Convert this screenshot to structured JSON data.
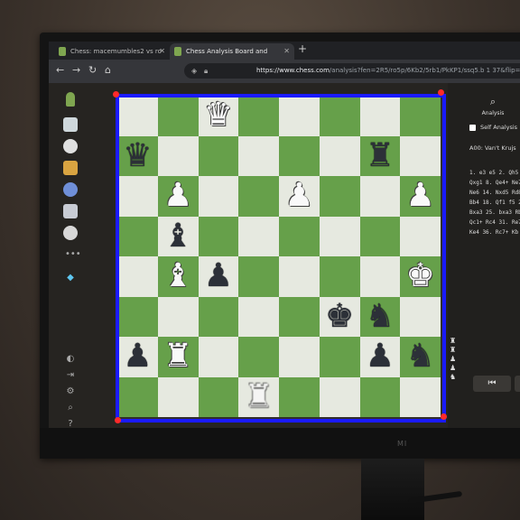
{
  "browser": {
    "tabs": [
      {
        "label": "Chess: macemumbles2 vs ro"
      },
      {
        "label": "Chess Analysis Board and"
      }
    ],
    "new_tab": "+",
    "url_host": "https://www.chess.com",
    "url_path": "/analysis?fen=2R5/ro5p/6Kb2/5rb1/PkKP1/ssq5.b 1 37&flip=misc"
  },
  "board": {
    "ranks": [
      [
        "",
        "",
        "wQ",
        "",
        "",
        "",
        "",
        ""
      ],
      [
        "bQ",
        "",
        "",
        "",
        "",
        "",
        "bR",
        ""
      ],
      [
        "",
        "wP",
        "",
        "",
        "wP",
        "",
        "",
        "wP"
      ],
      [
        "",
        "bB",
        "",
        "",
        "",
        "",
        "",
        ""
      ],
      [
        "",
        "wB",
        "bP",
        "",
        "",
        "",
        "",
        "wK"
      ],
      [
        "",
        "",
        "",
        "",
        "",
        "bK",
        "bN",
        ""
      ],
      [
        "bP",
        "wR",
        "",
        "",
        "",
        "",
        "bP",
        "bN"
      ],
      [
        "",
        "",
        "",
        "wR",
        "",
        "",
        "",
        ""
      ]
    ]
  },
  "panel": {
    "analysis_label": "Analysis",
    "self_analysis": "Self Analysis",
    "opening": "A00: Van't Krujs",
    "moves": [
      "1. e3 e5 2. Qh5 Qf",
      "Qxg1 8. Qe4+ Ne7",
      "Ne6 14. Nxd5 Rd8",
      "Bb4 18. Qf1 f5 20.",
      "Bxa3 25. bxa3 Rb",
      "Qc1+ Rc4 31. Re7",
      "Ke4 36. Rc7+ Kb"
    ]
  },
  "monitor_brand": "MI",
  "colors": {
    "board_light": "#e6e9e0",
    "board_dark": "#66a04a",
    "outline": "#1a1aff",
    "corner": "#ff2a2a"
  }
}
